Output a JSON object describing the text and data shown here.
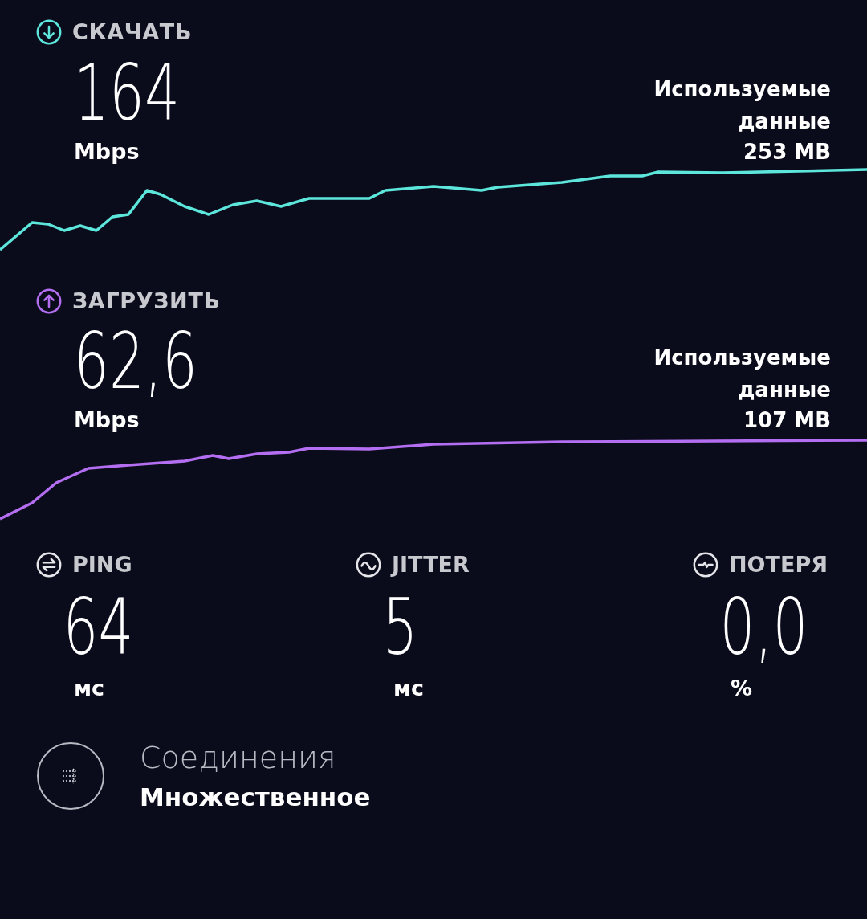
{
  "tests": [
    {
      "kind": "download",
      "color": "#5ce6dc",
      "label": "СКАЧАТЬ",
      "value": "164",
      "unit": "Mbps",
      "data_label": "Используемые данные",
      "data_value": "253 MB"
    },
    {
      "kind": "upload",
      "color": "#b46ef2",
      "label": "ЗАГРУЗИТЬ",
      "value": "62,6",
      "unit": "Mbps",
      "data_label": "Используемые данные",
      "data_value": "107 MB"
    }
  ],
  "stats": [
    {
      "kind": "ping",
      "label": "PING",
      "value": "64",
      "unit": "мс"
    },
    {
      "kind": "jitter",
      "label": "JITTER",
      "value": "5",
      "unit": "мс"
    },
    {
      "kind": "loss",
      "label": "ПОТЕРЯ",
      "value": "0,0",
      "unit": "%"
    }
  ],
  "connections": {
    "label": "Соединения",
    "value": "Множественное"
  }
}
